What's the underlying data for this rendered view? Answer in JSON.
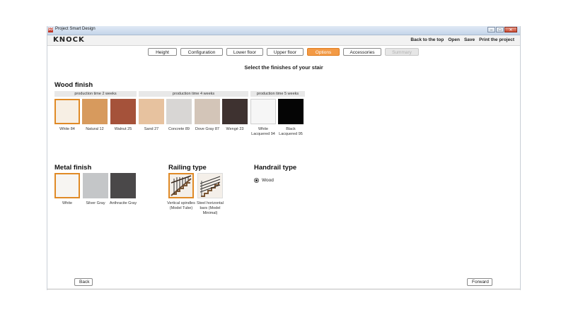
{
  "window": {
    "title": "Project Smart Design",
    "icon": "app-icon",
    "controls": [
      "minimize-icon",
      "maximize-icon",
      "close-icon"
    ]
  },
  "app": {
    "logo": "KNOCK"
  },
  "toplinks": [
    "Back to the top",
    "Open",
    "Save",
    "Print the project"
  ],
  "steps": [
    {
      "label": "Height",
      "state": "normal"
    },
    {
      "label": "Configuration",
      "state": "normal"
    },
    {
      "label": "Lower floor",
      "state": "normal"
    },
    {
      "label": "Upper floor",
      "state": "normal"
    },
    {
      "label": "Options",
      "state": "active"
    },
    {
      "label": "Accessories",
      "state": "normal"
    },
    {
      "label": "Summary",
      "state": "disabled"
    }
  ],
  "subtitle": "Select the finishes of your stair",
  "wood": {
    "heading": "Wood finish",
    "bands": [
      "production time 2 weeks",
      "production time 4 weeks",
      "production time 5 weeks"
    ],
    "items": [
      {
        "label": "White 84",
        "color": "#f7efe4",
        "selected": true
      },
      {
        "label": "Natural 12",
        "color": "#d79a5d",
        "selected": false
      },
      {
        "label": "Walnut 25",
        "color": "#a5523a",
        "selected": false
      },
      {
        "label": "Sand 27",
        "color": "#e7c29f",
        "selected": false
      },
      {
        "label": "Concrete 89",
        "color": "#d8d6d4",
        "selected": false
      },
      {
        "label": "Dove Gray 87",
        "color": "#d3c5b8",
        "selected": false
      },
      {
        "label": "Wengé 23",
        "color": "#3e3230",
        "selected": false
      },
      {
        "label": "White Lacquered 94",
        "color": "#f6f6f6",
        "selected": false
      },
      {
        "label": "Black Lacquered 95",
        "color": "#050505",
        "selected": false
      }
    ]
  },
  "metal": {
    "heading": "Metal finish",
    "items": [
      {
        "label": "White",
        "color": "#f7f5f2",
        "selected": true
      },
      {
        "label": "Silver Gray",
        "color": "#c4c6c8",
        "selected": false
      },
      {
        "label": "Anthracite Gray",
        "color": "#4a4849",
        "selected": false
      }
    ]
  },
  "railing": {
    "heading": "Railing type",
    "items": [
      {
        "label": "Vertical spindles (Model Tube)",
        "selected": true
      },
      {
        "label": "Steel horizontal bars (Model Minimal)",
        "selected": false
      }
    ]
  },
  "handrail": {
    "heading": "Handrail type",
    "option": "Wood"
  },
  "nav": {
    "back": "Back",
    "forward": "Forward"
  }
}
